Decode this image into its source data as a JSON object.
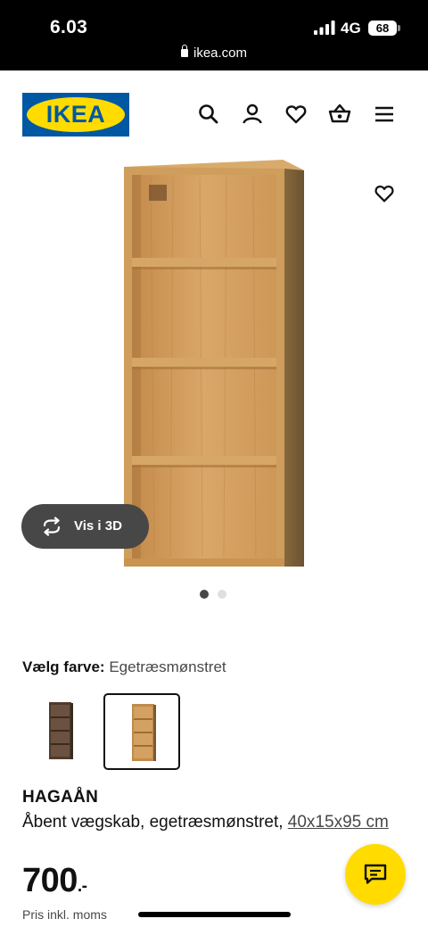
{
  "status_bar": {
    "time": "6.03",
    "network": "4G",
    "battery": "68",
    "url": "ikea.com"
  },
  "header": {
    "logo_text": "IKEA",
    "icons": [
      "search-icon",
      "account-icon",
      "heart-icon",
      "basket-icon",
      "menu-icon"
    ]
  },
  "gallery": {
    "view_3d_label": "Vis i 3D",
    "image_count": 2,
    "active_image": 1
  },
  "color_chooser": {
    "label": "Vælg farve:",
    "selected_value": "Egetræsmønstret",
    "options": [
      {
        "name": "brown",
        "color": "#5c4636",
        "selected": false
      },
      {
        "name": "oak",
        "color": "#c79a5e",
        "selected": true
      }
    ]
  },
  "product": {
    "name": "HAGAÅN",
    "description": "Åbent vægskab, egetræsmønstret,",
    "dimensions": "40x15x95 cm",
    "price": "700",
    "price_suffix": ".-",
    "price_note": "Pris inkl. moms"
  },
  "colors": {
    "brand_blue": "#0058a3",
    "brand_yellow": "#ffdb00",
    "status_bar_bg": "#000000"
  }
}
